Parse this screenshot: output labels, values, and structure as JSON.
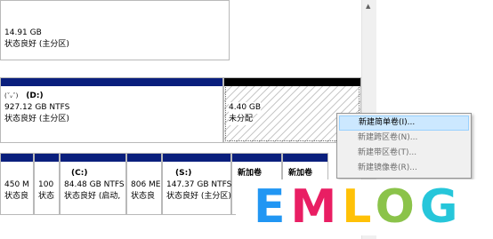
{
  "disk_top": {
    "size": "14.91 GB",
    "status": "状态良好 (主分区)"
  },
  "volume_d": {
    "prefix": "(ˇᵥˇ)",
    "letter": "(D:)",
    "size": "927.12 GB NTFS",
    "status": "状态良好 (主分区)"
  },
  "unallocated": {
    "size": "4.40 GB",
    "status": "未分配"
  },
  "bottom_partitions": [
    {
      "size": "450 M",
      "status": "状态良"
    },
    {
      "size": "100",
      "status": "状态"
    },
    {
      "letter": "(C:)",
      "size": "84.48 GB NTFS",
      "status": "状态良好 (启动,"
    },
    {
      "size": "806 ME",
      "status": "状态良"
    },
    {
      "letter": "(S:)",
      "size": "147.37 GB NTFS",
      "status": "状态良好 (主分区)"
    },
    {
      "letter": "新加卷"
    },
    {
      "letter": "新加卷"
    }
  ],
  "context_menu": [
    {
      "label": "新建简单卷(I)...",
      "enabled": true,
      "highlighted": true
    },
    {
      "label": "新建跨区卷(N)...",
      "enabled": false
    },
    {
      "label": "新建带区卷(T)...",
      "enabled": false
    },
    {
      "label": "新建镜像卷(R)...",
      "enabled": false
    }
  ],
  "watermark": {
    "letters": [
      "E",
      "M",
      "L",
      "O",
      "G"
    ],
    "colors": [
      "#2196f3",
      "#e91e63",
      "#ffc107",
      "#8bc34a",
      "#26c6da"
    ]
  },
  "colors": {
    "primary_bar": "#0a1f7d",
    "unallocated_bar": "#000000",
    "menu_highlight": "#cce8ff"
  }
}
